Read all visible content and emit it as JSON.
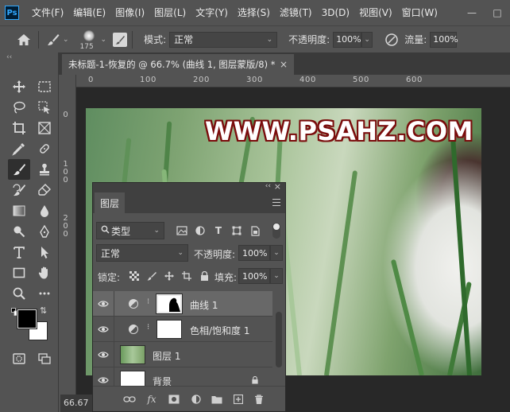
{
  "app": {
    "logo": "Ps",
    "menu": [
      "文件(F)",
      "编辑(E)",
      "图像(I)",
      "图层(L)",
      "文字(Y)",
      "选择(S)",
      "滤镜(T)",
      "3D(D)",
      "视图(V)",
      "窗口(W)"
    ]
  },
  "window_controls": {
    "minimize": "—",
    "maximize": "□"
  },
  "options_bar": {
    "brush_size": "175",
    "mode_label": "模式:",
    "mode_value": "正常",
    "opacity_label": "不透明度:",
    "opacity_value": "100%",
    "flow_label": "流量:",
    "flow_value": "100%"
  },
  "document_tab": {
    "title": "未标题-1-恢复的 @ 66.7% (曲线 1, 图层蒙版/8) *",
    "close": "×"
  },
  "rulers": {
    "top": [
      "0",
      "1",
      "0",
      "0",
      "2",
      "0",
      "0",
      "3",
      "0",
      "0",
      "4",
      "0",
      "0",
      "5",
      "0",
      "0",
      "6",
      "0",
      "0"
    ],
    "left": [
      "0",
      "1",
      "0",
      "0",
      "2",
      "0",
      "0"
    ]
  },
  "watermark": "WWW.PSAHZ.COM",
  "zoom_status": "66.67",
  "layers_panel": {
    "tab": "图层",
    "kind_filter": "类型",
    "blend_mode": "正常",
    "opacity_label": "不透明度:",
    "opacity_value": "100%",
    "lock_label": "锁定:",
    "fill_label": "填充:",
    "fill_value": "100%",
    "layers": [
      {
        "name": "曲线 1",
        "type": "curves-adjustment",
        "visible": true,
        "selected": true
      },
      {
        "name": "色相/饱和度 1",
        "type": "hue-saturation-adjustment",
        "visible": true,
        "selected": false
      },
      {
        "name": "图层 1",
        "type": "pixel",
        "visible": true,
        "selected": false
      },
      {
        "name": "背景",
        "type": "background",
        "visible": true,
        "selected": false,
        "locked": true
      }
    ]
  },
  "toolbar_header": "‹‹",
  "colors": {
    "foreground": "#000000",
    "background": "#ffffff",
    "accent": "#31a8ff",
    "watermark_outline": "#7a0c0c"
  }
}
